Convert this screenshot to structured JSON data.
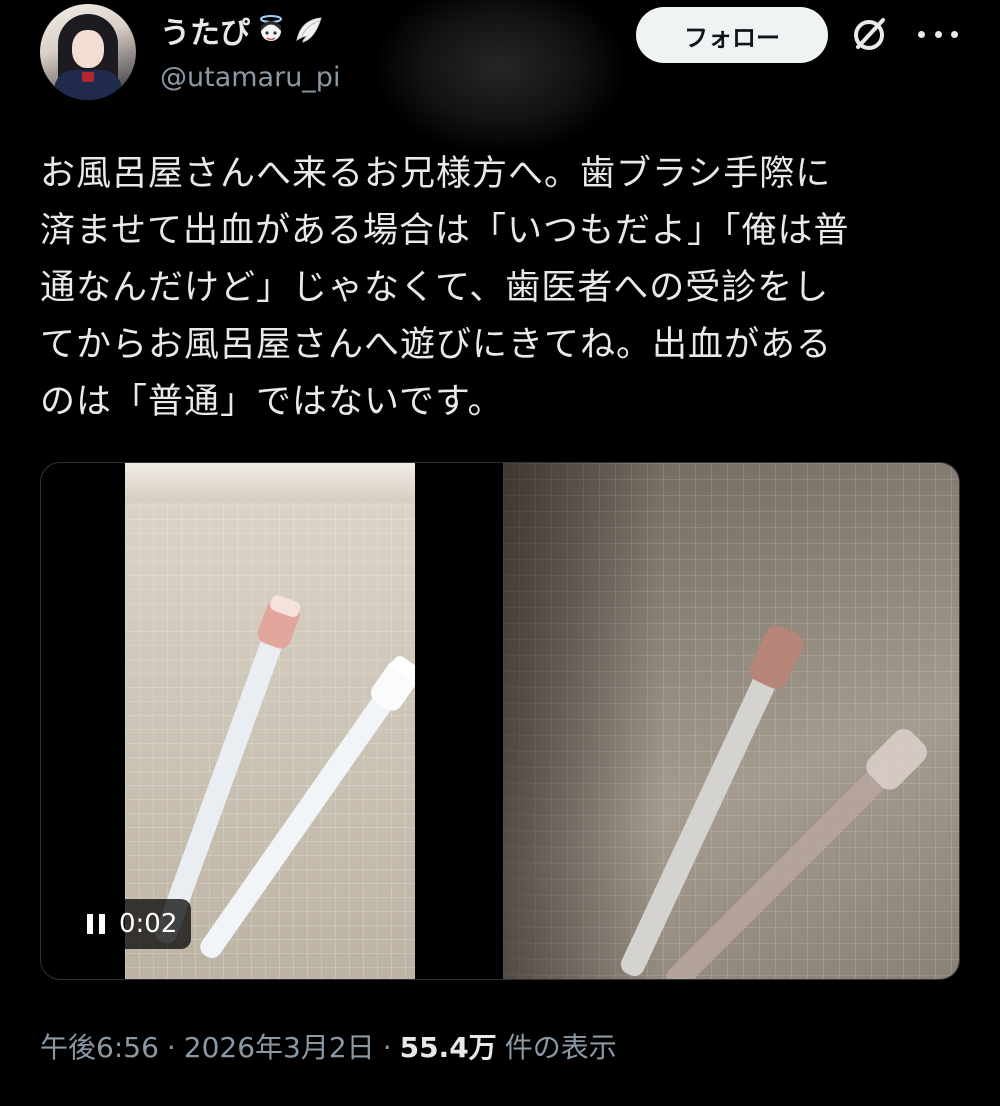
{
  "user": {
    "display_name": "うたぴ",
    "emoji_icons": [
      "angel-face-emoji",
      "wing-emoji"
    ],
    "handle": "@utamaru_pi"
  },
  "header": {
    "follow_label": "フォロー"
  },
  "tweet": {
    "lines": [
      "お風呂屋さんへ来るお兄様方へ。歯ブラシ手際に",
      "済ませて出血がある場合は「いつもだよ」「俺は普",
      "通なんだけど」じゃなくて、歯医者への受診をし",
      "てからお風呂屋さんへ遊びにきてね。出血がある",
      "のは「普通」ではないです。"
    ]
  },
  "media": {
    "video_time": "0:02"
  },
  "meta": {
    "time": "午後6:56",
    "separator": "·",
    "date": "2026年3月2日",
    "views_count": "55.4万",
    "views_label": "件の表示"
  },
  "colors": {
    "background": "#000000",
    "text_primary": "#e7e9ea",
    "text_secondary": "#8b98a5",
    "follow_bg": "#eff3f4"
  }
}
